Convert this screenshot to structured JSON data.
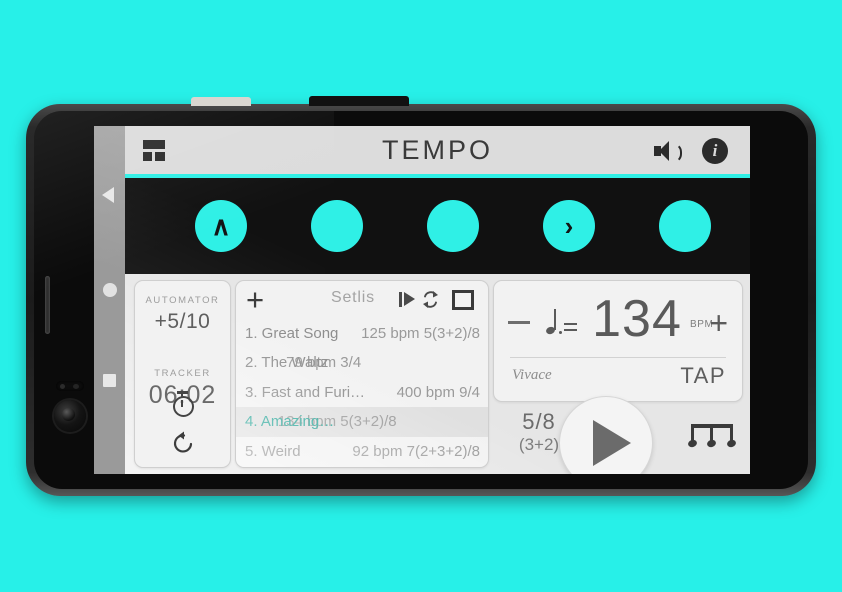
{
  "app": {
    "title": "TEMPO",
    "menu_icon": "grid-icon",
    "sound_icon": "speaker-icon",
    "info_icon": "info-icon",
    "accent_color": "#2ff0e6"
  },
  "beats": [
    {
      "glyph": "∧",
      "name": "beat-accent-strong"
    },
    {
      "glyph": "",
      "name": "beat-normal"
    },
    {
      "glyph": "",
      "name": "beat-normal"
    },
    {
      "glyph": "›",
      "name": "beat-accent-medium"
    },
    {
      "glyph": "",
      "name": "beat-normal"
    }
  ],
  "automator": {
    "label": "AUTOMATOR",
    "value": "+5/10",
    "tracker_label": "TRACKER",
    "tracker_value": "06:02",
    "stopwatch_icon": "stopwatch-icon",
    "reset_icon": "reset-icon"
  },
  "setlist": {
    "add_label": "+",
    "title": "Setlis",
    "play_next_icon": "play-next-icon",
    "loop_icon": "loop-icon",
    "fullscreen_icon": "fullscreen-icon",
    "rows": [
      {
        "name": "1. Great Song",
        "meta": "125 bpm 5(3+2)/8",
        "selected": false
      },
      {
        "name": "2. The Waltz",
        "meta": "79 bpm 3/4",
        "selected": false
      },
      {
        "name": "3. Fast and Furi…",
        "meta": "400 bpm 9/4",
        "selected": false
      },
      {
        "name": "4. Amazing…",
        "meta": "134 bpm 5(3+2)/8",
        "selected": true
      },
      {
        "name": "5. Weird",
        "meta": "92 bpm 7(2+3+2)/8",
        "selected": false
      }
    ]
  },
  "tempo": {
    "decrease_label": "−",
    "increase_label": "+",
    "note_icon": "dotted-quarter-note-icon",
    "bpm_value": "134",
    "bpm_unit": "BPM",
    "marking": "Vivace",
    "tap_label": "TAP",
    "meter_top": "5/8",
    "meter_grouping": "(3+2)",
    "subdivision_icon": "triplet-notes-icon",
    "play_icon": "play-icon"
  },
  "system_nav": {
    "back_icon": "back-triangle-icon",
    "home_icon": "home-circle-icon",
    "recents_icon": "recents-square-icon"
  }
}
